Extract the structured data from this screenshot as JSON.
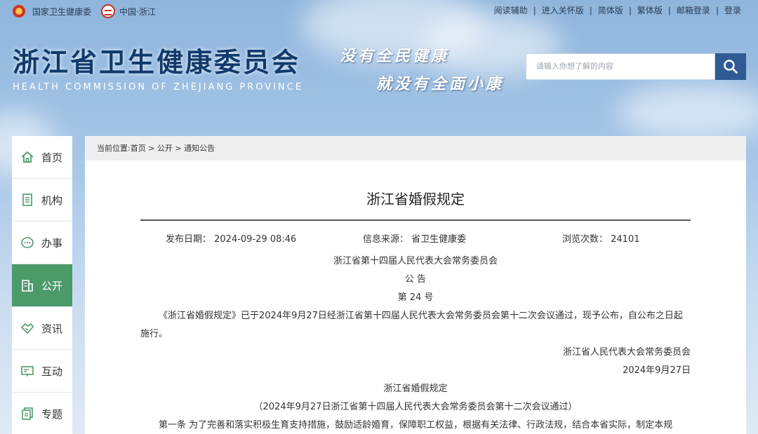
{
  "topbar": {
    "left_links": [
      "国家卫生健康委",
      "中国·浙江"
    ],
    "right_links": [
      "阅读辅助",
      "进入关怀版",
      "简体版",
      "繁体版",
      "邮箱登录",
      "登录"
    ]
  },
  "header": {
    "title": "浙江省卫生健康委员会",
    "subtitle": "HEALTH COMMISSION OF ZHEJIANG PROVINCE",
    "slogan_line1": "没有全民健康",
    "slogan_line2": "就没有全面小康",
    "search_placeholder": "请输入你想了解的内容"
  },
  "sidebar": {
    "items": [
      {
        "label": "首页",
        "icon": "home-icon"
      },
      {
        "label": "机构",
        "icon": "document-icon"
      },
      {
        "label": "办事",
        "icon": "chat-icon"
      },
      {
        "label": "公开",
        "icon": "building-icon",
        "active": true
      },
      {
        "label": "资讯",
        "icon": "handshake-icon"
      },
      {
        "label": "互动",
        "icon": "board-icon"
      },
      {
        "label": "专题",
        "icon": "copy-icon"
      }
    ]
  },
  "breadcrumb": "当前位置:首页 > 公开 > 通知公告",
  "article": {
    "title": "浙江省婚假规定",
    "publish_date": "发布日期： 2024-09-29 08:46",
    "source": "信息来源： 省卫生健康委",
    "views": "浏览次数： 24101",
    "issuer": "浙江省第十四届人民代表大会常务委员会",
    "notice": "公  告",
    "number": "第 24 号",
    "body1": "《浙江省婚假规定》已于2024年9月27日经浙江省第十四届人民代表大会常务委员会第十二次会议通过，现予公布，自公布之日起",
    "body1b": "施行。",
    "sign_org": "浙江省人民代表大会常务委员会",
    "sign_date": "2024年9月27日",
    "reg_title": "浙江省婚假规定",
    "reg_note": "（2024年9月27日浙江省第十四届人民代表大会常务委员会第十二次会议通过）",
    "article1": "第一条   为了完善和落实积极生育支持措施，鼓励适龄婚育，保障职工权益，根据有关法律、行政法规，结合本省实际，制定本规"
  },
  "colors": {
    "accent": "#4a9a6a",
    "search_button": "#2f5a93",
    "title": "#123a6b"
  }
}
